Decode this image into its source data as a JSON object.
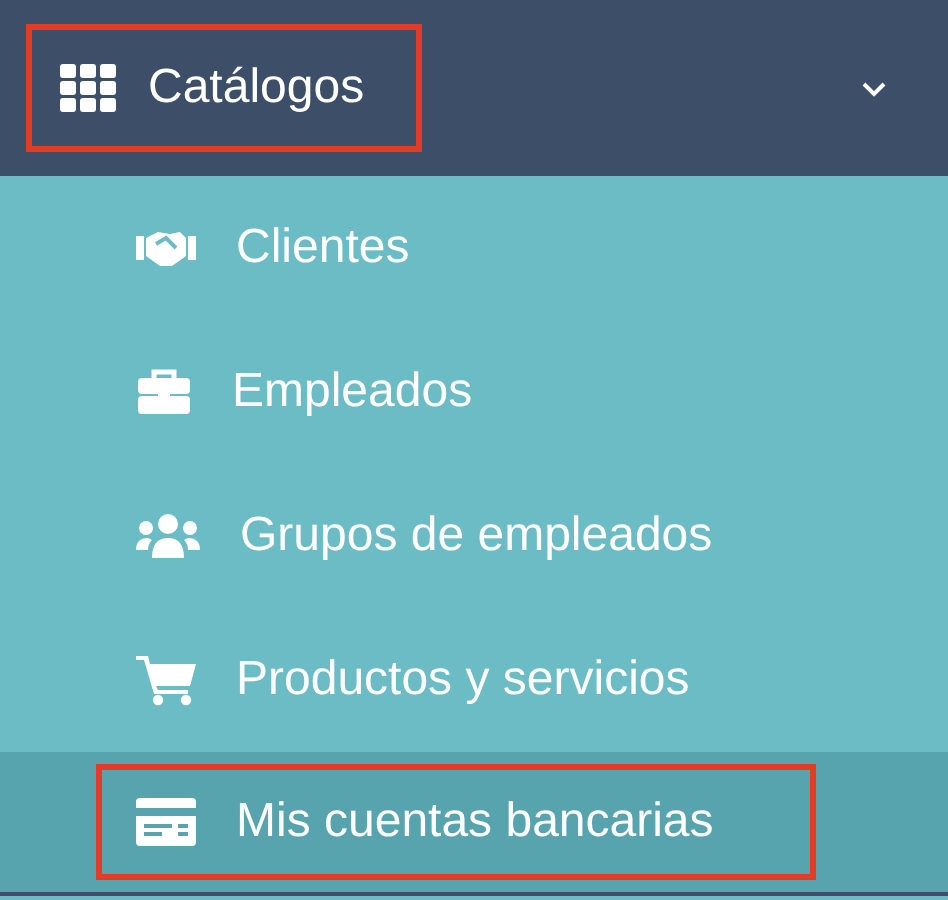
{
  "menu": {
    "label": "Catálogos",
    "expanded": true,
    "highlighted": true,
    "items": [
      {
        "label": "Clientes",
        "selected": false,
        "highlighted": false
      },
      {
        "label": "Empleados",
        "selected": false,
        "highlighted": false
      },
      {
        "label": "Grupos de empleados",
        "selected": false,
        "highlighted": false
      },
      {
        "label": "Productos y servicios",
        "selected": false,
        "highlighted": false
      },
      {
        "label": "Mis cuentas bancarias",
        "selected": true,
        "highlighted": true
      }
    ]
  }
}
